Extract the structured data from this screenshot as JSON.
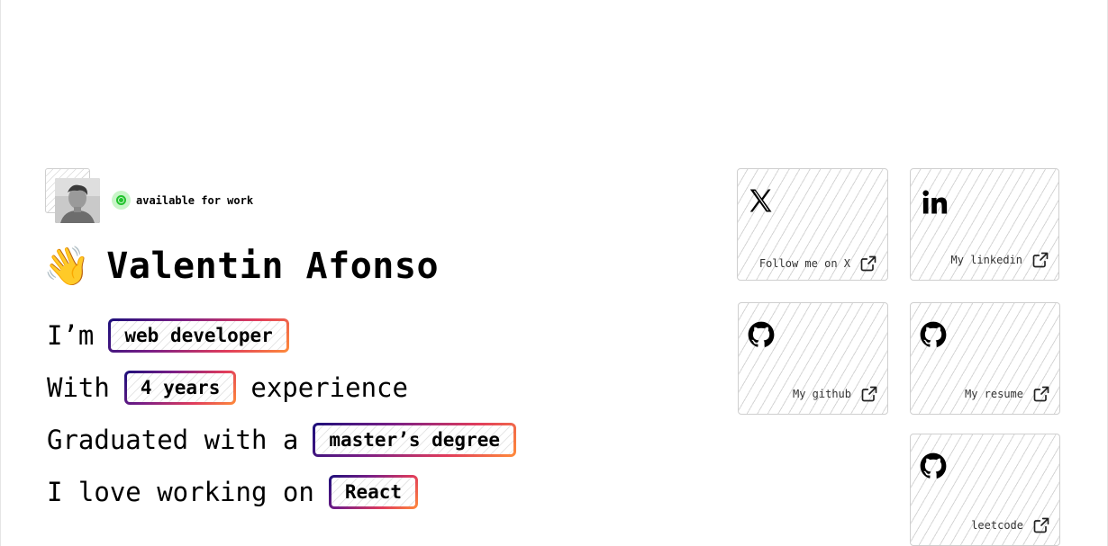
{
  "profile": {
    "status": "available for work",
    "wave_emoji": "👋",
    "name": "Valentin Afonso"
  },
  "intro": {
    "lines": [
      {
        "before": "I’m",
        "highlight": "web developer",
        "after": ""
      },
      {
        "before": "With",
        "highlight": "4 years",
        "after": "experience"
      },
      {
        "before": "Graduated with a",
        "highlight": "master’s degree",
        "after": ""
      },
      {
        "before": "I love working on",
        "highlight": "React",
        "after": ""
      }
    ]
  },
  "cards": {
    "x": {
      "label": "Follow me on X",
      "icon": "x-logo-icon"
    },
    "linkedin": {
      "label": "My linkedin",
      "icon": "linkedin-icon"
    },
    "github": {
      "label": "My github",
      "icon": "github-icon"
    },
    "resume": {
      "label": "My resume",
      "icon": "github-icon"
    },
    "leetcode": {
      "label": "leetcode",
      "icon": "github-icon"
    }
  },
  "colors": {
    "status_green": "#22c32e",
    "pill_gradient_start": "#1b0f7a",
    "pill_gradient_end": "#ff8c3a"
  }
}
